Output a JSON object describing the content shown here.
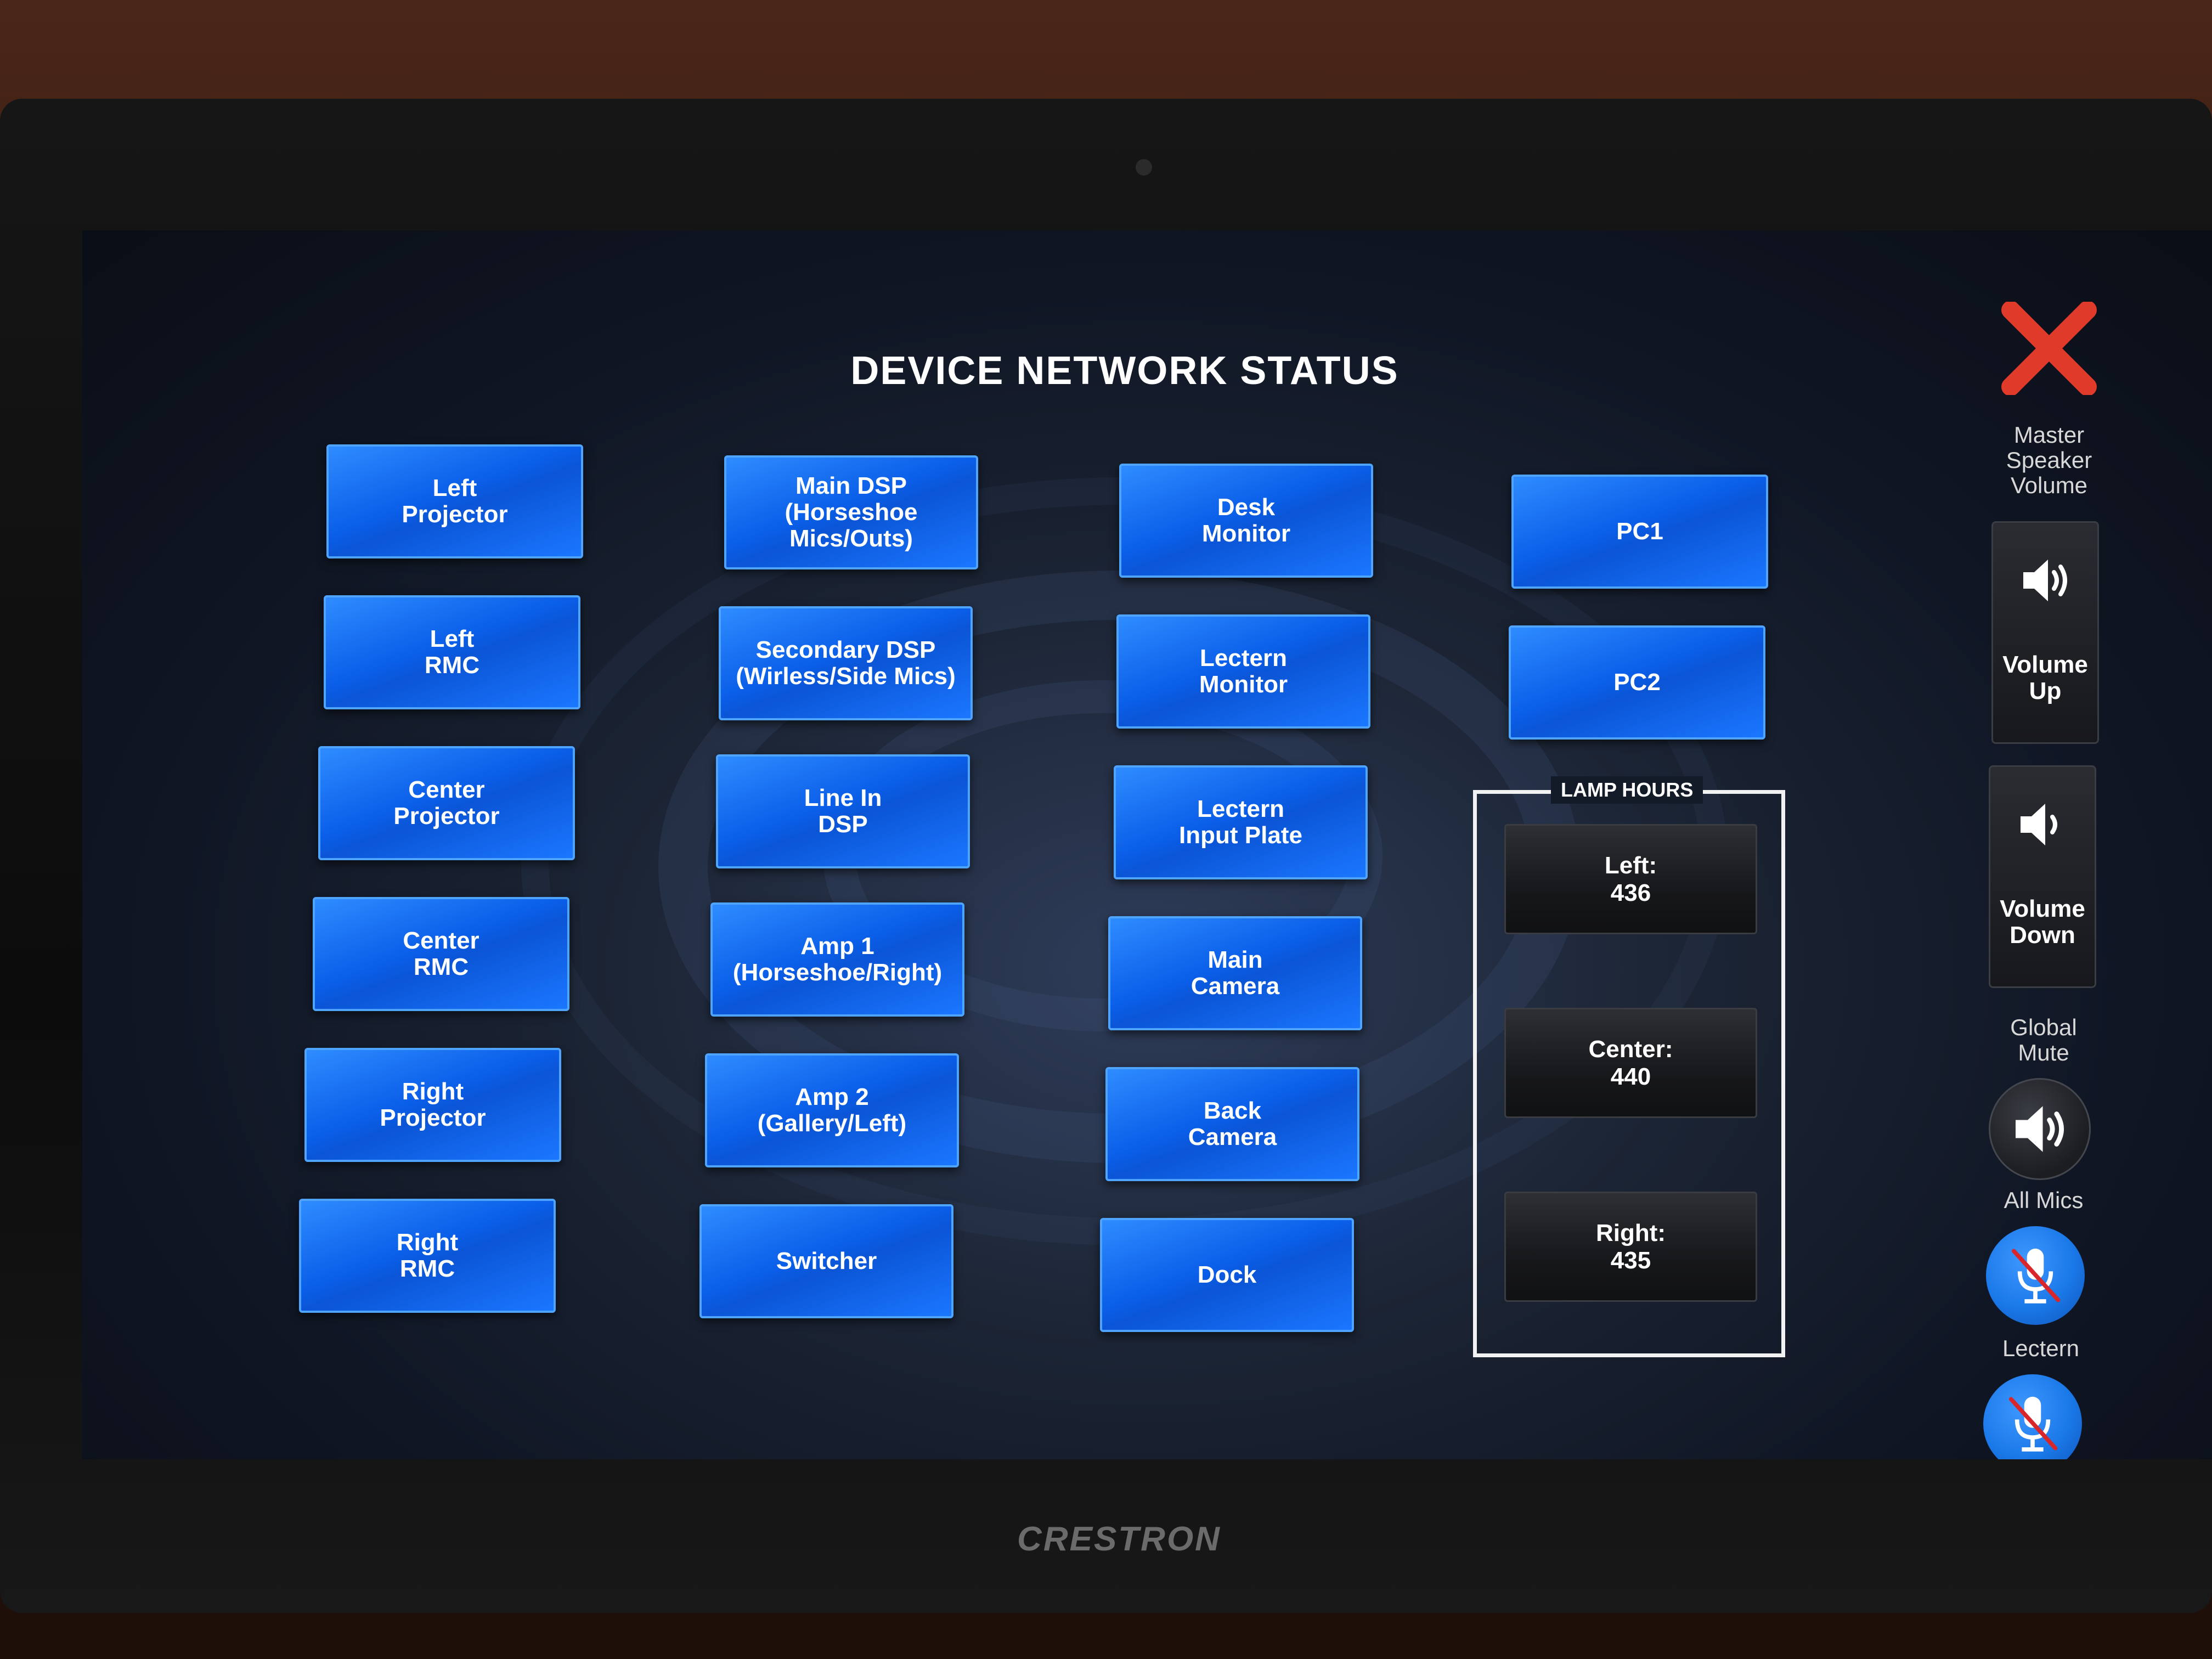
{
  "screen": {
    "title": "DEVICE NETWORK STATUS"
  },
  "devices": {
    "col1": [
      {
        "label": "Left\nProjector"
      },
      {
        "label": "Left\nRMC"
      },
      {
        "label": "Center\nProjector"
      },
      {
        "label": "Center\nRMC"
      },
      {
        "label": "Right\nProjector"
      },
      {
        "label": "Right\nRMC"
      }
    ],
    "col2": [
      {
        "label": "Main DSP\n(Horseshoe\nMics/Outs)"
      },
      {
        "label": "Secondary DSP\n(Wirless/Side Mics)"
      },
      {
        "label": "Line In\nDSP"
      },
      {
        "label": "Amp 1\n(Horseshoe/Right)"
      },
      {
        "label": "Amp 2\n(Gallery/Left)"
      },
      {
        "label": "Switcher"
      }
    ],
    "col3": [
      {
        "label": "Desk\nMonitor"
      },
      {
        "label": "Lectern\nMonitor"
      },
      {
        "label": "Lectern\nInput Plate"
      },
      {
        "label": "Main\nCamera"
      },
      {
        "label": "Back\nCamera"
      },
      {
        "label": "Dock"
      }
    ],
    "col4": [
      {
        "label": "PC1"
      },
      {
        "label": "PC2"
      }
    ]
  },
  "lamp_hours": {
    "title": "LAMP HOURS",
    "left": "Left:\n436",
    "center": "Center:\n440",
    "right": "Right:\n435"
  },
  "sidebar": {
    "master_label": "Master\nSpeaker\nVolume",
    "volume_up": "Volume\nUp",
    "volume_down": "Volume\nDown",
    "global_mute": "Global\nMute",
    "all_mics": "All Mics",
    "lectern": "Lectern"
  },
  "brand": {
    "logo_text": "CRESTRON"
  },
  "colors": {
    "button_blue": "#0b5fe8",
    "close_red": "#e03a2a",
    "mic_blue": "#1a78e8"
  }
}
